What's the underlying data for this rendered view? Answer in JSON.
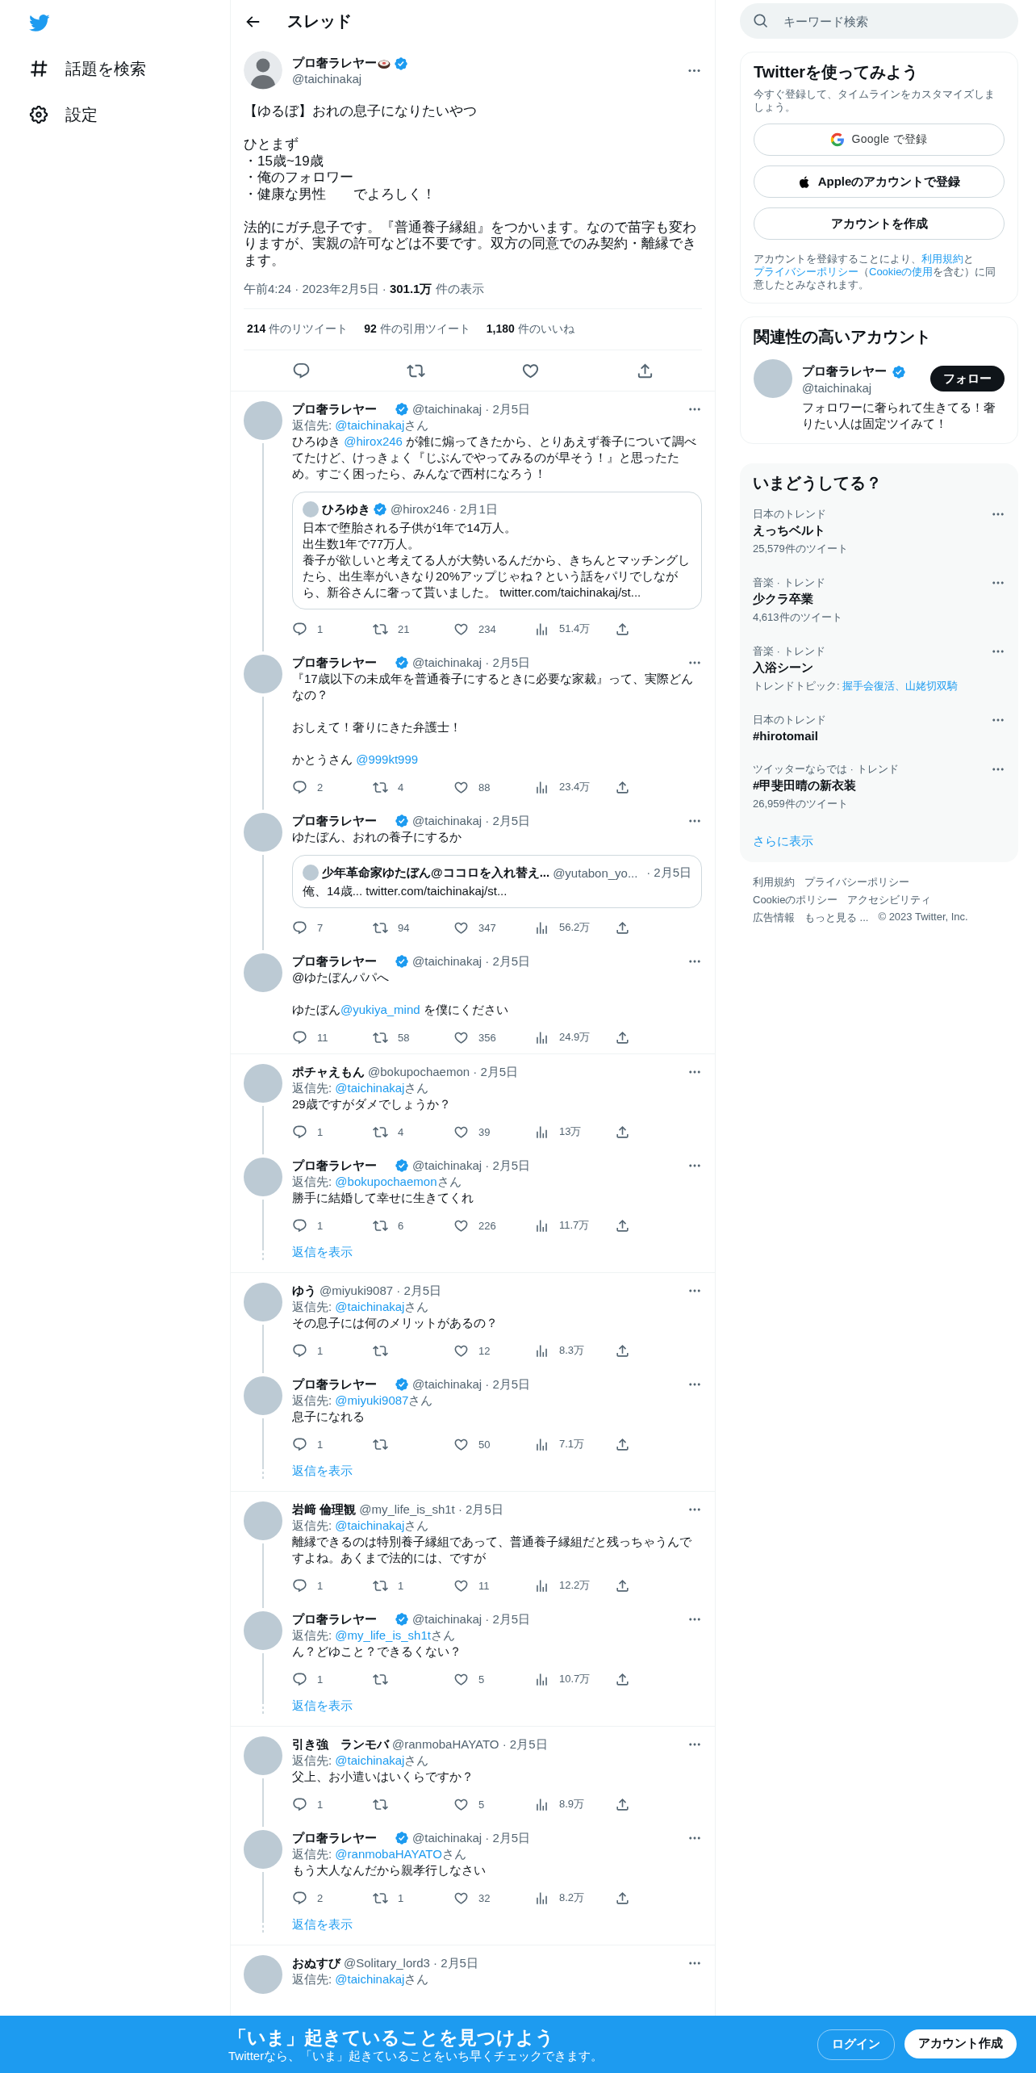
{
  "sidebar": {
    "items": [
      {
        "label": "話題を検索",
        "kind": "explore"
      },
      {
        "label": "設定",
        "kind": "settings"
      }
    ]
  },
  "header": {
    "title": "スレッド"
  },
  "main_tweet": {
    "name": "プロ奢ラレヤー",
    "verified": true,
    "handle": "@taichinakaj",
    "paragraphs": [
      [
        "【ゆるぼ】おれの息子になりたいやつ"
      ],
      [
        "ひとまず",
        "・15歳~19歳",
        "・俺のフォロワー",
        "・健康な男性　　でよろしく！"
      ],
      [
        "法的にガチ息子です。『普通養子縁組』をつかいます。なので苗字も変わりますが、実親の許可などは不要です。双方の同意でのみ契約・離縁できます。"
      ]
    ],
    "meta": "午前4:24 · 2023年2月5日 · **301.1万** 件の表示",
    "stats": [
      "**214** 件のリツイート",
      "**92** 件の引用ツイート",
      "**1,180** 件のいいね"
    ]
  },
  "threads": [
    {
      "tweets": [
        {
          "name": "プロ奢ラレヤー",
          "verified": true,
          "meta": "@taichinakaj · 2月5日",
          "reply_to": [
            {
              "text": "返信先: "
            },
            {
              "text": "@taichinakaj",
              "kind": "mention"
            },
            {
              "text": "さん"
            }
          ],
          "paragraphs": [
            [
              {
                "text": "ひろゆき "
              },
              {
                "text": "@hirox246",
                "kind": "mention"
              },
              {
                "text": " が雑に煽ってきたから、とりあえず養子について調べてたけど、けっきょく『じぶんでやってみるのが早そう！』と思ったため。すごく困ったら、みんなで西村になろう！"
              }
            ]
          ],
          "quote": {
            "name": "ひろゆき",
            "verified": true,
            "meta": "@hirox246 · 2月1日",
            "lines": [
              "日本で堕胎される子供が1年で14万人。",
              "出生数1年で77万人。",
              "養子が欲しいと考えてる人が大勢いるんだから、きちんとマッチングしたら、出生率がいきなり20%アップじゃね？という話をパリでしながら、新谷さんに奢って貰いました。 twitter.com/taichinakaj/st..."
            ]
          },
          "actions": {
            "replies": "1",
            "retweets": "21",
            "likes": "234",
            "views": "51.4万"
          }
        },
        {
          "name": "プロ奢ラレヤー",
          "verified": true,
          "meta": "@taichinakaj · 2月5日",
          "paragraphs": [
            "『17歳以下の未成年を普通養子にするときに必要な家裁』って、実際どんなの？",
            "おしえて！奢りにきた弁護士！",
            [
              {
                "text": "かとうさん "
              },
              {
                "text": "@999kt999",
                "kind": "mention"
              }
            ]
          ],
          "actions": {
            "replies": "2",
            "retweets": "4",
            "likes": "88",
            "views": "23.4万"
          }
        },
        {
          "name": "プロ奢ラレヤー",
          "verified": true,
          "meta": "@taichinakaj · 2月5日",
          "paragraphs": [
            "ゆたぼん、おれの養子にするか"
          ],
          "quote": {
            "name": "少年革命家ゆたぼん@ココロを入れ替え...",
            "verified": false,
            "meta": "@yutabon_yo...",
            "date": "· 2月5日",
            "lines": [
              "俺、14歳... twitter.com/taichinakaj/st..."
            ]
          },
          "actions": {
            "replies": "7",
            "retweets": "94",
            "likes": "347",
            "views": "56.2万"
          }
        },
        {
          "name": "プロ奢ラレヤー",
          "verified": true,
          "meta": "@taichinakaj · 2月5日",
          "paragraphs": [
            "@ゆたぼんパパへ",
            [
              {
                "text": "ゆたぼん"
              },
              {
                "text": "@yukiya_mind",
                "kind": "mention"
              },
              {
                "text": " を僕にください"
              }
            ]
          ],
          "actions": {
            "replies": "11",
            "retweets": "58",
            "likes": "356",
            "views": "24.9万"
          }
        }
      ]
    },
    {
      "show_replies": "返信を表示",
      "tweets": [
        {
          "name": "ポチャえもん",
          "verified": false,
          "meta": "@bokupochaemon · 2月5日",
          "reply_to": [
            {
              "text": "返信先: "
            },
            {
              "text": "@taichinakaj",
              "kind": "mention"
            },
            {
              "text": "さん"
            }
          ],
          "paragraphs": [
            "29歳ですがダメでしょうか？"
          ],
          "actions": {
            "replies": "1",
            "retweets": "4",
            "likes": "39",
            "views": "13万"
          }
        },
        {
          "name": "プロ奢ラレヤー",
          "verified": true,
          "meta": "@taichinakaj · 2月5日",
          "reply_to": [
            {
              "text": "返信先: "
            },
            {
              "text": "@bokupochaemon",
              "kind": "mention"
            },
            {
              "text": "さん"
            }
          ],
          "paragraphs": [
            "勝手に結婚して幸せに生きてくれ"
          ],
          "actions": {
            "replies": "1",
            "retweets": "6",
            "likes": "226",
            "views": "11.7万"
          }
        }
      ]
    },
    {
      "show_replies": "返信を表示",
      "tweets": [
        {
          "name": "ゆう",
          "verified": false,
          "meta": "@miyuki9087 · 2月5日",
          "reply_to": [
            {
              "text": "返信先: "
            },
            {
              "text": "@taichinakaj",
              "kind": "mention"
            },
            {
              "text": "さん"
            }
          ],
          "paragraphs": [
            "その息子には何のメリットがあるの？"
          ],
          "actions": {
            "replies": "1",
            "likes": "12",
            "views": "8.3万"
          }
        },
        {
          "name": "プロ奢ラレヤー",
          "verified": true,
          "meta": "@taichinakaj · 2月5日",
          "reply_to": [
            {
              "text": "返信先: "
            },
            {
              "text": "@miyuki9087",
              "kind": "mention"
            },
            {
              "text": "さん"
            }
          ],
          "paragraphs": [
            "息子になれる"
          ],
          "actions": {
            "replies": "1",
            "likes": "50",
            "views": "7.1万"
          }
        }
      ]
    },
    {
      "show_replies": "返信を表示",
      "tweets": [
        {
          "name": "岩﨑 倫理観",
          "verified": false,
          "meta": "@my_life_is_sh1t · 2月5日",
          "reply_to": [
            {
              "text": "返信先: "
            },
            {
              "text": "@taichinakaj",
              "kind": "mention"
            },
            {
              "text": "さん"
            }
          ],
          "paragraphs": [
            "離縁できるのは特別養子縁組であって、普通養子縁組だと残っちゃうんですよね。あくまで法的には、ですが"
          ],
          "actions": {
            "replies": "1",
            "retweets": "1",
            "likes": "11",
            "views": "12.2万"
          }
        },
        {
          "name": "プロ奢ラレヤー",
          "verified": true,
          "meta": "@taichinakaj · 2月5日",
          "reply_to": [
            {
              "text": "返信先: "
            },
            {
              "text": "@my_life_is_sh1t",
              "kind": "mention"
            },
            {
              "text": "さん"
            }
          ],
          "paragraphs": [
            "ん？どゆこと？できるくない？"
          ],
          "actions": {
            "replies": "1",
            "likes": "5",
            "views": "10.7万"
          }
        }
      ]
    },
    {
      "show_replies": "返信を表示",
      "tweets": [
        {
          "name": "引き強　ランモバ",
          "verified": false,
          "meta": "@ranmobaHAYATO · 2月5日",
          "reply_to": [
            {
              "text": "返信先: "
            },
            {
              "text": "@taichinakaj",
              "kind": "mention"
            },
            {
              "text": "さん"
            }
          ],
          "paragraphs": [
            "父上、お小遣いはいくらですか？"
          ],
          "actions": {
            "replies": "1",
            "likes": "5",
            "views": "8.9万"
          }
        },
        {
          "name": "プロ奢ラレヤー",
          "verified": true,
          "meta": "@taichinakaj · 2月5日",
          "reply_to": [
            {
              "text": "返信先: "
            },
            {
              "text": "@ranmobaHAYATO",
              "kind": "mention"
            },
            {
              "text": "さん"
            }
          ],
          "paragraphs": [
            "もう大人なんだから親孝行しなさい"
          ],
          "actions": {
            "replies": "2",
            "retweets": "1",
            "likes": "32",
            "views": "8.2万"
          }
        }
      ]
    },
    {
      "tweets": [
        {
          "name": "おぬすび",
          "verified": false,
          "meta": "@Solitary_lord3 · 2月5日",
          "reply_to": [
            {
              "text": "返信先: "
            },
            {
              "text": "@taichinakaj",
              "kind": "mention"
            },
            {
              "text": "さん"
            }
          ]
        }
      ]
    }
  ],
  "search": {
    "placeholder": "キーワード検索"
  },
  "signup": {
    "title": "Twitterを使ってみよう",
    "description": "今すぐ登録して、タイムラインをカスタマイズしましょう。",
    "buttons": [
      {
        "label": "Google で登録",
        "kind": "google"
      },
      {
        "label": "Appleのアカウントで登録",
        "kind": "apple"
      },
      {
        "label": "アカウントを作成",
        "kind": "plain"
      }
    ],
    "terms": [
      {
        "text": "アカウントを登録することにより、"
      },
      {
        "text": "利用規約",
        "kind": "link"
      },
      {
        "text": "と"
      },
      {
        "text": "プライバシーポリシー",
        "kind": "link"
      },
      {
        "text": "（"
      },
      {
        "text": "Cookieの使用",
        "kind": "link"
      },
      {
        "text": "を含む）に同意したとみなされます。"
      }
    ]
  },
  "related": {
    "title": "関連性の高いアカウント",
    "accounts": [
      {
        "name": "プロ奢ラレヤー",
        "verified": true,
        "handle": "@taichinakaj",
        "button": "フォロー",
        "bio": "フォロワーに奢られて生きてる！奢りたい人は固定ツイみて！"
      }
    ]
  },
  "trends": {
    "title": "いまどうしてる？",
    "items": [
      {
        "context": "日本のトレンド",
        "title": "えっちベルト",
        "detail": "25,579件のツイート"
      },
      {
        "context": "音楽 · トレンド",
        "title": "少クラ卒業",
        "detail": "4,613件のツイート"
      },
      {
        "context": "音楽 · トレンド",
        "title": "入浴シーン",
        "detail": [
          {
            "text": "トレンドトピック: "
          },
          {
            "text": "握手会復活、山姥切双騎",
            "kind": "link"
          }
        ]
      },
      {
        "context": "日本のトレンド",
        "title": "#hirotomail"
      },
      {
        "context": "ツイッターならでは · トレンド",
        "title": "#甲斐田晴の新衣装",
        "detail": "26,959件のツイート"
      }
    ],
    "more": "さらに表示"
  },
  "footer": {
    "links": [
      "利用規約",
      "プライバシーポリシー",
      "Cookieのポリシー",
      "アクセシビリティ",
      "広告情報",
      "もっと見る ..."
    ],
    "copyright": "© 2023 Twitter, Inc."
  },
  "bottom_bar": {
    "title": "「いま」起きていることを見つけよう",
    "subtitle": "Twitterなら、「いま」起きていることをいち早くチェックできます。",
    "buttons": [
      {
        "label": "ログイン",
        "kind": "outline"
      },
      {
        "label": "アカウント作成",
        "kind": "filled"
      }
    ]
  }
}
